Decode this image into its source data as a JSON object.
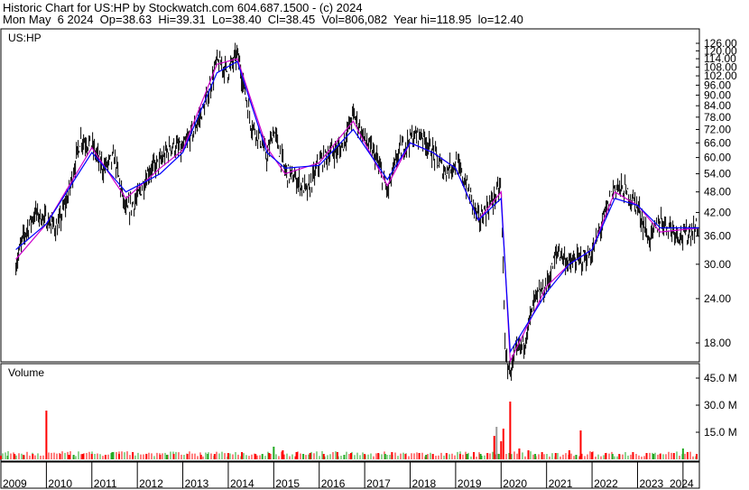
{
  "header": {
    "line1": "Historic Chart for US:HP by Stockwatch.com 604.687.1500 - (c) 2024",
    "line2": "Mon May  6 2024  Op=38.63  Hi=39.31  Lo=38.40  Cl=38.45  Vol=806,082  Year hi=118.95  lo=12.40"
  },
  "chart_data": [
    {
      "type": "line",
      "title": "US:HP",
      "y_ticks": [
        18,
        24,
        30,
        36,
        42,
        48,
        54,
        60,
        66,
        72,
        78,
        84,
        90,
        96,
        102,
        108,
        114,
        120,
        126
      ],
      "scale": "log",
      "x_labels": [
        "2009",
        "2010",
        "2011",
        "2012",
        "2013",
        "2014",
        "2015",
        "2016",
        "2017",
        "2018",
        "2019",
        "2020",
        "2021",
        "2022",
        "2023",
        "2024"
      ],
      "series": [
        {
          "color": "#000000",
          "style": "price bars",
          "x": [
            2009.33,
            2009.5,
            2009.75,
            2010.0,
            2010.25,
            2010.5,
            2010.75,
            2011.0,
            2011.25,
            2011.5,
            2011.75,
            2012.0,
            2012.25,
            2012.5,
            2012.75,
            2013.0,
            2013.25,
            2013.5,
            2013.75,
            2014.0,
            2014.2,
            2014.35,
            2014.5,
            2014.7,
            2014.85,
            2015.0,
            2015.25,
            2015.5,
            2015.75,
            2016.0,
            2016.25,
            2016.5,
            2016.75,
            2017.0,
            2017.25,
            2017.5,
            2017.75,
            2018.0,
            2018.25,
            2018.5,
            2018.75,
            2019.0,
            2019.25,
            2019.5,
            2019.75,
            2020.0,
            2020.1,
            2020.2,
            2020.35,
            2020.5,
            2020.75,
            2021.0,
            2021.25,
            2021.5,
            2021.75,
            2022.0,
            2022.25,
            2022.5,
            2022.75,
            2023.0,
            2023.25,
            2023.5,
            2023.75,
            2024.0,
            2024.35
          ],
          "y": [
            30,
            36,
            42,
            40,
            38,
            48,
            68,
            65,
            56,
            60,
            42,
            46,
            55,
            58,
            65,
            63,
            72,
            85,
            112,
            105,
            118,
            95,
            75,
            68,
            60,
            72,
            55,
            52,
            48,
            58,
            62,
            64,
            80,
            68,
            60,
            48,
            62,
            68,
            70,
            62,
            55,
            58,
            50,
            40,
            44,
            50,
            16,
            15,
            17,
            18,
            24,
            26,
            33,
            30,
            31,
            32,
            40,
            50,
            48,
            44,
            35,
            40,
            38,
            36,
            38.45
          ]
        },
        {
          "color": "#cc00cc",
          "style": "short moving average",
          "x": [
            2009.33,
            2010.0,
            2011.0,
            2011.75,
            2012.5,
            2013.0,
            2013.75,
            2014.2,
            2014.85,
            2015.25,
            2016.0,
            2016.75,
            2017.5,
            2018.0,
            2018.5,
            2019.0,
            2019.5,
            2020.0,
            2020.2,
            2021.0,
            2021.5,
            2022.0,
            2022.5,
            2023.0,
            2023.5,
            2024.35
          ],
          "y": [
            31,
            39,
            64,
            46,
            56,
            63,
            110,
            114,
            64,
            54,
            58,
            76,
            50,
            66,
            62,
            56,
            40,
            48,
            16,
            26,
            30,
            33,
            48,
            44,
            37,
            38
          ]
        },
        {
          "color": "#0000ff",
          "style": "long moving average",
          "x": [
            2009.33,
            2010.0,
            2011.0,
            2011.75,
            2012.5,
            2013.0,
            2013.75,
            2014.2,
            2014.85,
            2015.25,
            2016.0,
            2016.75,
            2017.5,
            2018.0,
            2018.5,
            2019.0,
            2019.5,
            2020.0,
            2020.2,
            2021.0,
            2021.5,
            2022.0,
            2022.5,
            2023.0,
            2023.5,
            2024.35
          ],
          "y": [
            33,
            39,
            62,
            48,
            54,
            62,
            104,
            112,
            62,
            56,
            57,
            72,
            52,
            66,
            62,
            56,
            40,
            46,
            17,
            25,
            30,
            33,
            46,
            44,
            38,
            38
          ]
        }
      ]
    },
    {
      "type": "bar",
      "title": "Volume",
      "y_ticks": [
        "15.0 M",
        "30.0 M",
        "45.0 M"
      ],
      "y_tick_values": [
        15,
        30,
        45
      ],
      "ylim": [
        0,
        52
      ],
      "series": [
        {
          "name": "",
          "color": "#ff0000",
          "x": [
            2009.0,
            2009.3,
            2009.5,
            2009.7,
            2010.0,
            2010.3,
            2010.5,
            2010.8,
            2011.0,
            2011.3,
            2011.6,
            2011.9,
            2012.2,
            2012.5,
            2012.8,
            2013.1,
            2013.4,
            2013.7,
            2014.0,
            2014.3,
            2014.6,
            2014.9,
            2015.2,
            2015.5,
            2015.8,
            2016.1,
            2016.4,
            2016.7,
            2017.0,
            2017.3,
            2017.6,
            2017.9,
            2018.2,
            2018.5,
            2018.8,
            2019.1,
            2019.4,
            2019.7,
            2019.85,
            2020.0,
            2020.05,
            2020.2,
            2020.4,
            2020.6,
            2020.9,
            2021.2,
            2021.5,
            2021.75,
            2022.0,
            2022.3,
            2022.6,
            2022.9,
            2023.2,
            2023.5,
            2023.8,
            2024.1,
            2024.3
          ],
          "y": [
            2,
            3,
            2.5,
            3,
            27,
            3,
            2.5,
            3,
            3,
            2.5,
            3,
            4,
            3,
            2.5,
            3,
            3,
            2.5,
            3,
            3.5,
            4,
            3,
            3.5,
            5,
            4,
            3.5,
            3,
            4,
            3.5,
            3,
            3.5,
            4,
            3,
            3.5,
            3,
            3.5,
            3,
            4,
            3.5,
            13,
            10,
            17,
            32,
            6,
            5,
            4,
            3.5,
            5,
            16,
            4,
            3.5,
            3,
            4,
            3.5,
            3,
            3.5,
            4,
            3
          ]
        },
        {
          "name": "",
          "color": "#22aa22",
          "x": [
            2009.15,
            2010.6,
            2011.45,
            2012.65,
            2013.55,
            2014.75,
            2015.0,
            2015.65,
            2016.55,
            2017.45,
            2018.35,
            2019.25,
            2019.55,
            2019.95,
            2020.75,
            2021.65,
            2022.45,
            2023.35,
            2024.0
          ],
          "y": [
            2,
            2.5,
            4,
            2.5,
            3,
            3,
            7,
            3,
            2.5,
            3,
            2.5,
            3,
            3,
            3,
            3,
            2.5,
            3,
            3,
            6
          ]
        },
        {
          "name": "",
          "color": "#999999",
          "x": [
            2019.9
          ],
          "y": [
            18
          ]
        }
      ]
    }
  ]
}
